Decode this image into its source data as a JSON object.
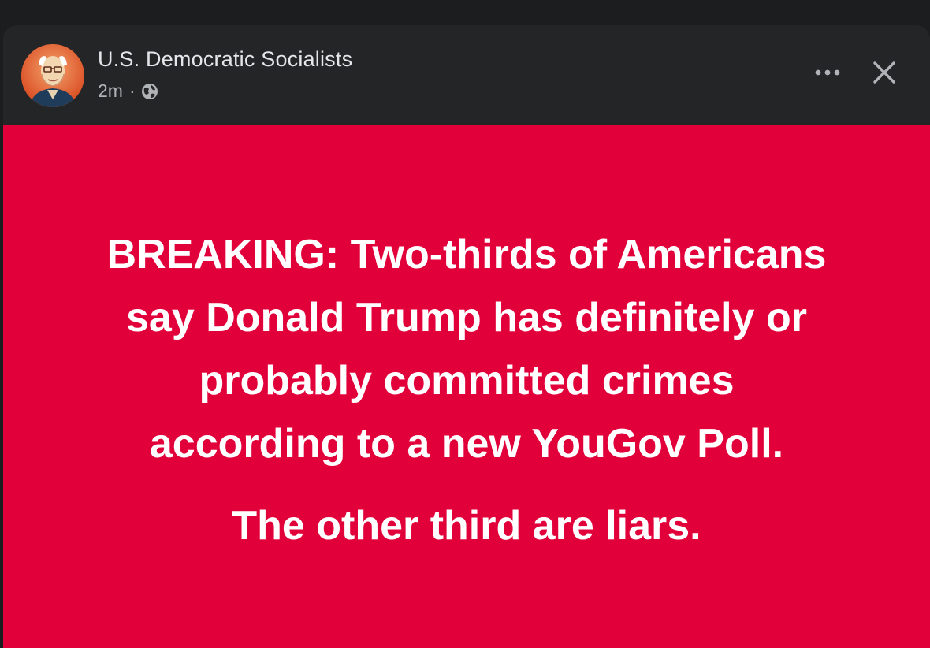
{
  "post": {
    "author": "U.S. Democratic Socialists",
    "time": "2m",
    "separator": "·",
    "privacy_icon": "globe-icon",
    "more_icon": "more-horizontal-icon",
    "close_icon": "close-icon",
    "avatar_icon": "portrait-avatar",
    "background_color": "#e1003a",
    "headline_lines": [
      "BREAKING: Two-thirds of Americans",
      "say Donald Trump has definitely or",
      "probably committed crimes",
      "according to a new YouGov Poll."
    ],
    "tagline": "The other third are liars."
  }
}
